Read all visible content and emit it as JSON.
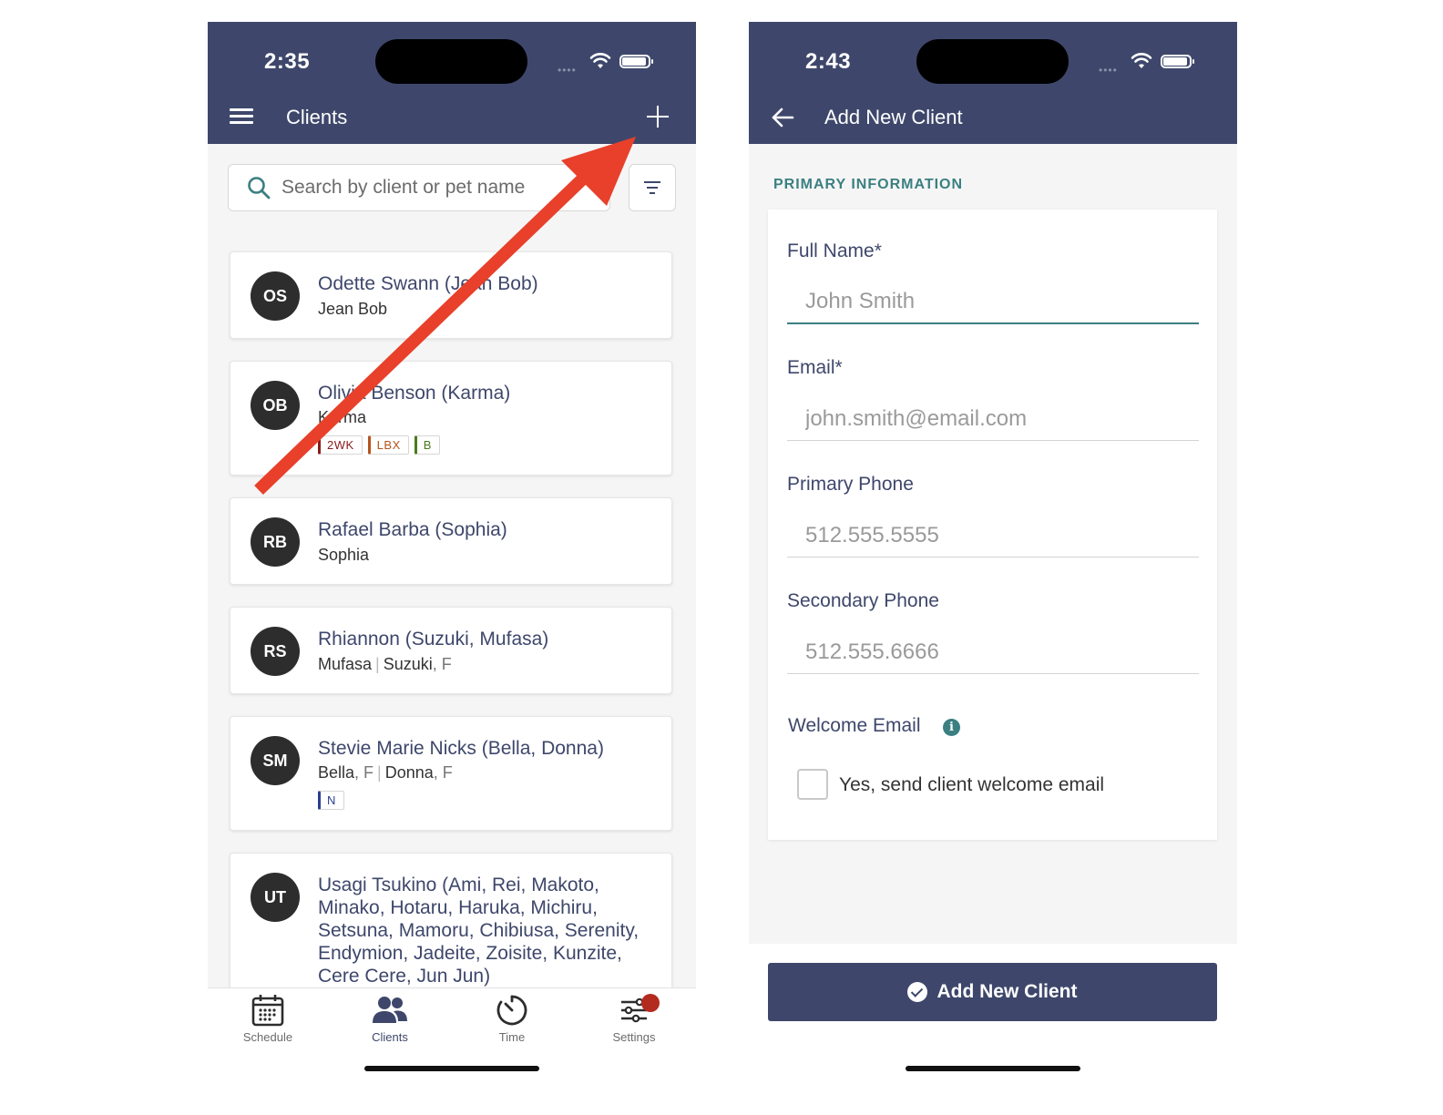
{
  "left_screen": {
    "status": {
      "time": "2:35"
    },
    "header": {
      "title": "Clients"
    },
    "search": {
      "placeholder": "Search by client or pet name"
    },
    "clients": [
      {
        "initials": "OS",
        "name": "Odette Swann (Jean Bob)",
        "pets": "Jean Bob"
      },
      {
        "initials": "OB",
        "name": "Olivia Benson (Karma)",
        "pets": "Karma",
        "tags": [
          {
            "label": "2WK",
            "color": "#8b1a1a"
          },
          {
            "label": "LBX",
            "color": "#b5531e"
          },
          {
            "label": "B",
            "color": "#4a7a1e"
          }
        ]
      },
      {
        "initials": "RB",
        "name": "Rafael Barba (Sophia)",
        "pets": "Sophia"
      },
      {
        "initials": "RS",
        "name": "Rhiannon (Suzuki, Mufasa)",
        "pet_1": "Mufasa",
        "pet_2": "Suzuki",
        "pet_2_sex": ", F"
      },
      {
        "initials": "SM",
        "name": "Stevie Marie Nicks (Bella, Donna)",
        "pet_1": "Bella",
        "pet_1_sex": ", F",
        "pet_2": "Donna",
        "pet_2_sex": ", F",
        "tags": [
          {
            "label": "N",
            "color": "#2a3f8f"
          }
        ]
      },
      {
        "initials": "UT",
        "name": "Usagi Tsukino (Ami, Rei, Makoto, Minako, Hotaru, Haruka, Michiru, Setsuna, Mamoru, Chibiusa, Serenity, Endymion, Jadeite, Zoisite, Kunzite, Cere Cere, Jun Jun)"
      }
    ],
    "tabs": [
      {
        "label": "Schedule",
        "icon": "calendar-icon"
      },
      {
        "label": "Clients",
        "icon": "people-icon"
      },
      {
        "label": "Time",
        "icon": "timer-icon"
      },
      {
        "label": "Settings",
        "icon": "sliders-icon"
      }
    ],
    "active_tab": "Clients"
  },
  "right_screen": {
    "status": {
      "time": "2:43"
    },
    "header": {
      "title": "Add New Client"
    },
    "section_title": "PRIMARY INFORMATION",
    "fields": {
      "full_name": {
        "label": "Full Name*",
        "placeholder": "John Smith"
      },
      "email": {
        "label": "Email*",
        "placeholder": "john.smith@email.com"
      },
      "primary_phone": {
        "label": "Primary Phone",
        "placeholder": "512.555.5555"
      },
      "secondary_phone": {
        "label": "Secondary Phone",
        "placeholder": "512.555.6666"
      }
    },
    "welcome_email": {
      "label": "Welcome Email",
      "checkbox_label": "Yes, send client welcome email",
      "checked": false
    },
    "submit_label": "Add New Client"
  },
  "colors": {
    "header_bg": "#3e476b",
    "accent_teal": "#3b7f82",
    "annotation_arrow": "#e8402a",
    "notification_dot": "#b32a1f"
  }
}
